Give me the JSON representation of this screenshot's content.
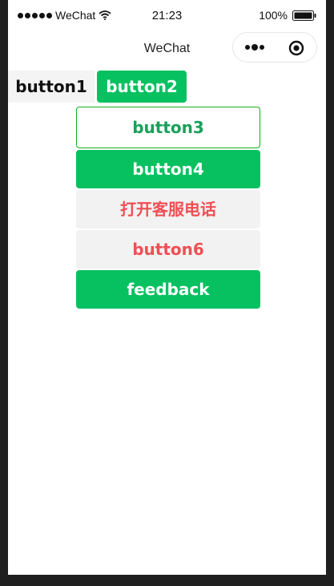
{
  "status_bar": {
    "carrier": "WeChat",
    "time": "21:23",
    "battery_percent": "100%",
    "battery_level": 1.0,
    "signal_icon": "signal-dots-icon",
    "wifi_icon": "wifi-icon",
    "battery_icon": "battery-icon"
  },
  "nav": {
    "title": "WeChat",
    "capsule_more_icon": "more-icon",
    "capsule_close_icon": "close-icon"
  },
  "buttons": {
    "button1": "button1",
    "button2": "button2",
    "button3": "button3",
    "button4": "button4",
    "contact": "打开客服电话",
    "button6": "button6",
    "feedback": "feedback"
  },
  "colors": {
    "primary_green": "#07c160",
    "warn_red": "#f04f54",
    "default_gray": "#f2f2f2"
  }
}
